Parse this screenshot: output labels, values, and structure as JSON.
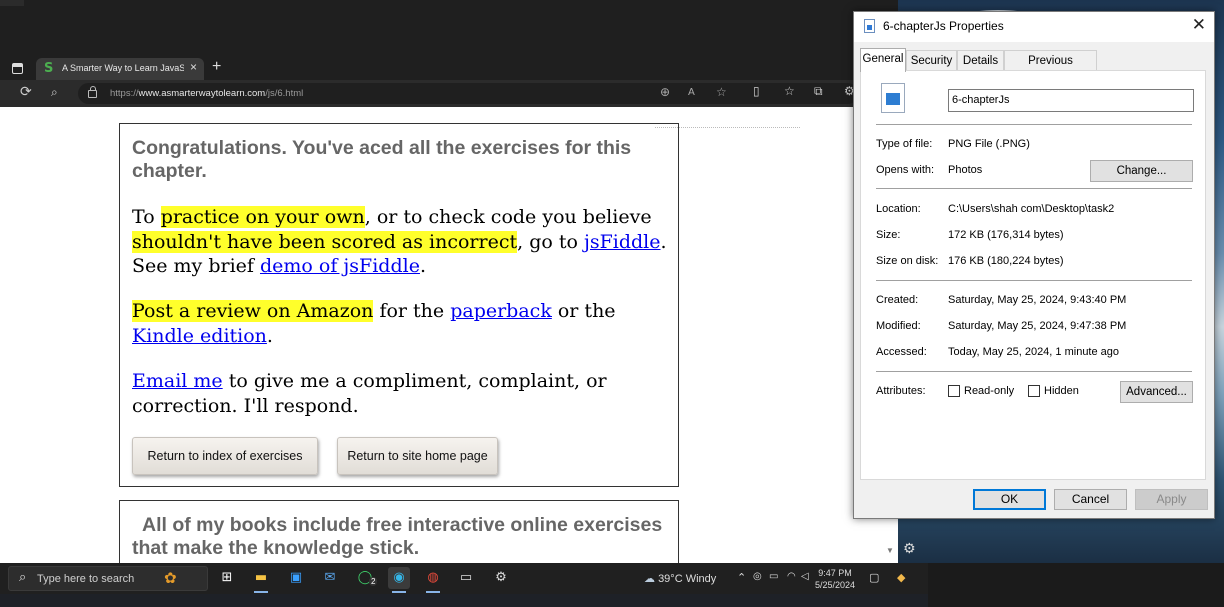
{
  "browser": {
    "tab_title": "A Smarter Way to Learn JavaScript",
    "tab_favicon": "S",
    "url_prefix": "https://",
    "url_domain": "www.asmarterwaytolearn.com",
    "url_path": "/js/6.html"
  },
  "page": {
    "heading": "Congratulations. You've aced all the exercises for this chapter.",
    "p1_a": "To ",
    "p1_hl1": "practice on your own",
    "p1_b": ", or to check code you believe ",
    "p1_hl2": "shouldn't have been scored as incorrect",
    "p1_c": ", go to ",
    "p1_link1": "jsFiddle",
    "p1_d": ". See my brief ",
    "p1_link2": "demo of jsFiddle",
    "p1_e": ".",
    "p2_hl": "Post a review on Amazon",
    "p2_a": " for the ",
    "p2_link1": "paperback",
    "p2_b": " or the ",
    "p2_link2": "Kindle edition",
    "p2_c": ".",
    "p3_link": "Email me",
    "p3_a": " to give me a compliment, complaint, or correction. I'll respond.",
    "btn_index": "Return to index of exercises",
    "btn_home": "Return to site home page",
    "heading2": "All of my books include free interactive online exercises that make the knowledge stick."
  },
  "dialog": {
    "title": "6-chapterJs Properties",
    "tabs": [
      "General",
      "Security",
      "Details",
      "Previous Versions"
    ],
    "file_name": "6-chapterJs",
    "type_label": "Type of file:",
    "type_value": "PNG File (.PNG)",
    "opens_label": "Opens with:",
    "opens_value": "Photos",
    "change_button": "Change...",
    "location_label": "Location:",
    "location_value": "C:\\Users\\shah com\\Desktop\\task2",
    "size_label": "Size:",
    "size_value": "172 KB (176,314 bytes)",
    "size_disk_label": "Size on disk:",
    "size_disk_value": "176 KB (180,224 bytes)",
    "created_label": "Created:",
    "created_value": "Saturday, May 25, 2024, 9:43:40 PM",
    "modified_label": "Modified:",
    "modified_value": "Saturday, May 25, 2024, 9:47:38 PM",
    "accessed_label": "Accessed:",
    "accessed_value": "Today, May 25, 2024, 1 minute ago",
    "attributes_label": "Attributes:",
    "readonly_label": "Read-only",
    "hidden_label": "Hidden",
    "advanced_button": "Advanced...",
    "ok": "OK",
    "cancel": "Cancel",
    "apply": "Apply"
  },
  "taskbar": {
    "search_placeholder": "Type here to search",
    "whatsapp_badge": "2",
    "temperature": "39°C",
    "weather": "Windy",
    "time": "9:47 PM",
    "date": "5/25/2024"
  },
  "colors": {
    "highlight": "#ffff2b",
    "link": "#0000ee",
    "dialog_accent": "#0078d7"
  }
}
